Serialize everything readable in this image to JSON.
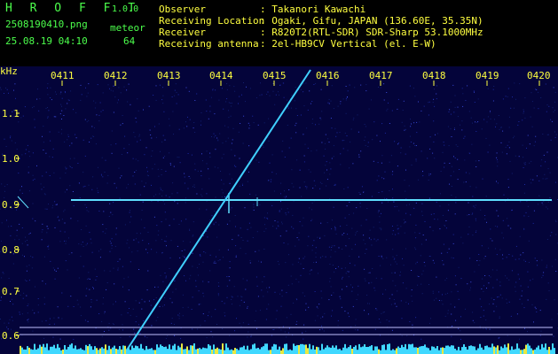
{
  "header": {
    "logo": "H R O F F T",
    "version": "1.0.0",
    "filename": "2508190410.png",
    "datetime": "25.08.19 04:10",
    "meteor_label": "meteor",
    "meteor_count": "64",
    "info": [
      {
        "label": "Observer",
        "value": ": Takanori Kawachi"
      },
      {
        "label": "Receiving Location",
        "value": ": Ogaki, Gifu, JAPAN (136.60E, 35.35N)"
      },
      {
        "label": "Receiver",
        "value": ": R820T2(RTL-SDR) SDR-Sharp 53.1000MHz"
      },
      {
        "label": "Receiving antenna",
        "value": ": 2el-HB9CV Vertical (el. E-W)"
      }
    ]
  },
  "plot": {
    "unit": "kHz",
    "time_ticks": [
      "0411",
      "0412",
      "0413",
      "0414",
      "0415",
      "0416",
      "0417",
      "0418",
      "0419",
      "0420"
    ],
    "freq_ticks": [
      "1.1",
      "1.0",
      "0.9",
      "0.8",
      "0.7",
      "0.6"
    ],
    "colors": {
      "background": "#04043a",
      "signal": "#40d0ff",
      "carrier": "#60e0ff",
      "label": "#ffff40"
    }
  }
}
